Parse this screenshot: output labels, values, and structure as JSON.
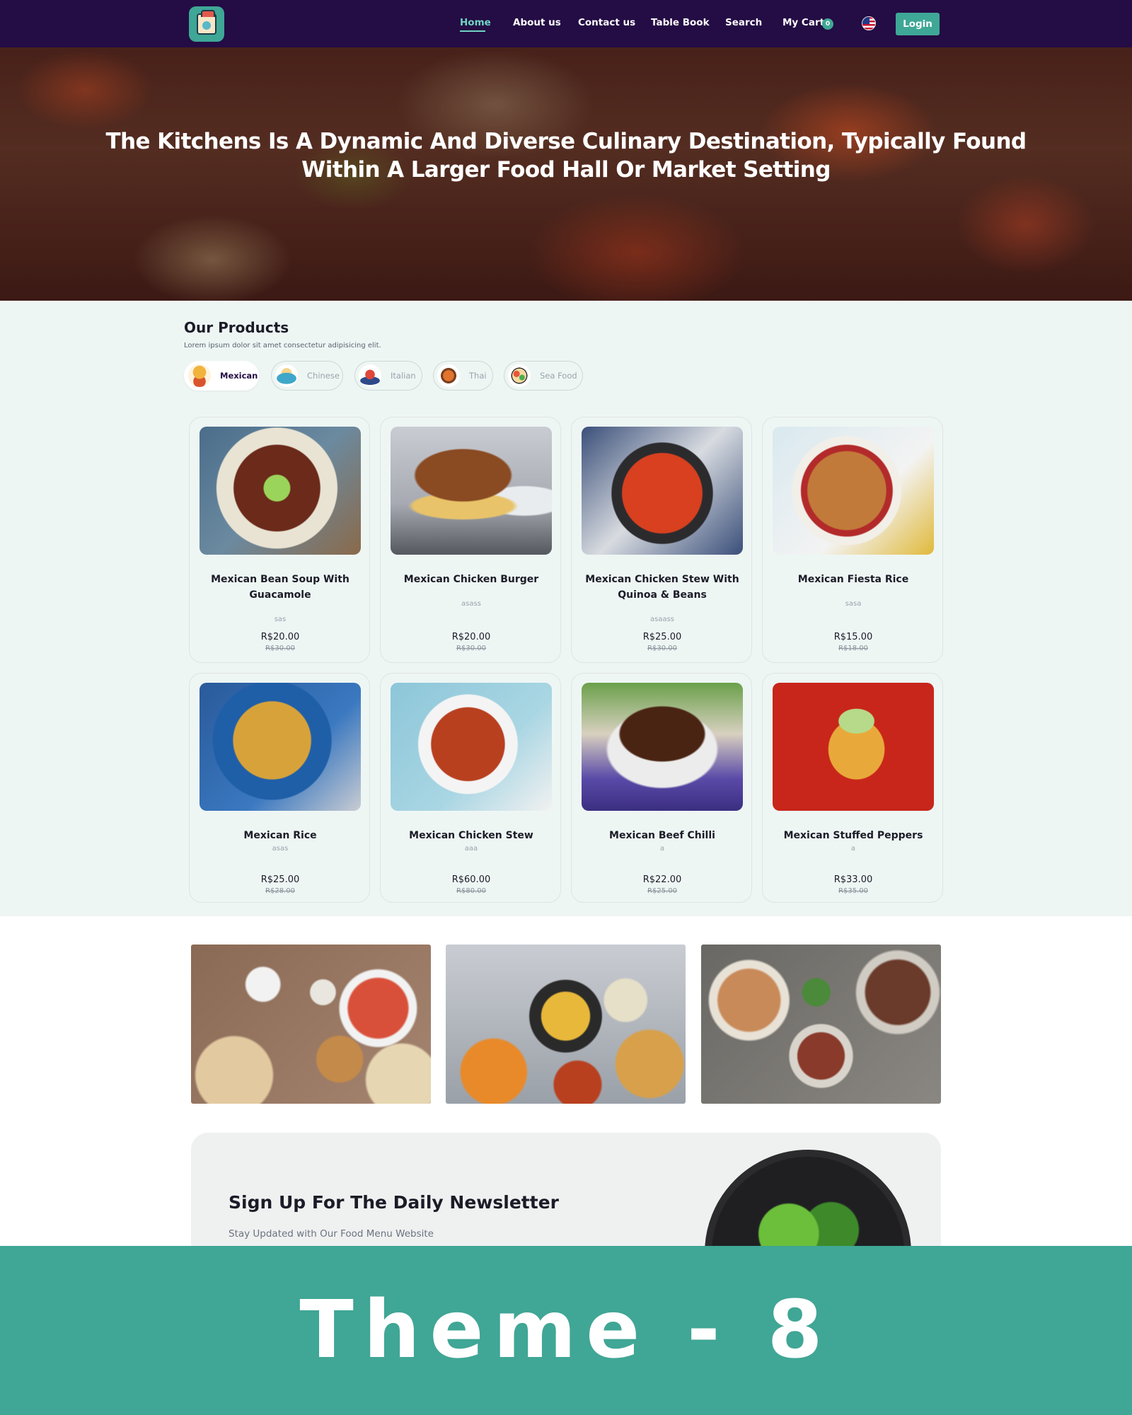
{
  "nav": {
    "links": [
      "Home",
      "About us",
      "Contact us",
      "Table Book",
      "Search",
      "My Cart"
    ],
    "cart_count": "0",
    "login_label": "Login",
    "language_icon": "us-flag-icon",
    "accent_color": "#3fa796",
    "background_color": "#240c44"
  },
  "hero": {
    "title": "The Kitchens Is A Dynamic And Diverse Culinary Destination, Typically Found Within A Larger Food Hall Or Market Setting"
  },
  "products": {
    "title": "Our Products",
    "subtitle": "Lorem ipsum dolor sit amet consectetur adipisicing elit.",
    "categories": [
      "Mexican",
      "Chinese",
      "Italian",
      "Thai",
      "Sea Food"
    ],
    "active_category": "Mexican",
    "items": [
      {
        "name": "Mexican Bean Soup With Guacamole",
        "desc": "sas",
        "price": "R$20.00",
        "old_price": "R$30.00"
      },
      {
        "name": "Mexican Chicken Burger",
        "desc": "asass",
        "price": "R$20.00",
        "old_price": "R$30.00"
      },
      {
        "name": "Mexican Chicken Stew With Quinoa & Beans",
        "desc": "asaass",
        "price": "R$25.00",
        "old_price": "R$30.00"
      },
      {
        "name": "Mexican Fiesta Rice",
        "desc": "sasa",
        "price": "R$15.00",
        "old_price": "R$18.00"
      },
      {
        "name": "Mexican Rice",
        "desc": "asas",
        "price": "R$25.00",
        "old_price": "R$28.00"
      },
      {
        "name": "Mexican Chicken Stew",
        "desc": "aaa",
        "price": "R$60.00",
        "old_price": "R$80.00"
      },
      {
        "name": "Mexican Beef Chilli",
        "desc": "a",
        "price": "R$22.00",
        "old_price": "R$25.00"
      },
      {
        "name": "Mexican Stuffed Peppers",
        "desc": "a",
        "price": "R$33.00",
        "old_price": "R$35.00"
      }
    ]
  },
  "newsletter": {
    "title": "Sign Up For The Daily Newsletter",
    "subtitle": "Stay Updated with Our Food Menu Website"
  },
  "banner": {
    "text": "Theme - 8",
    "color": "#40a695"
  }
}
